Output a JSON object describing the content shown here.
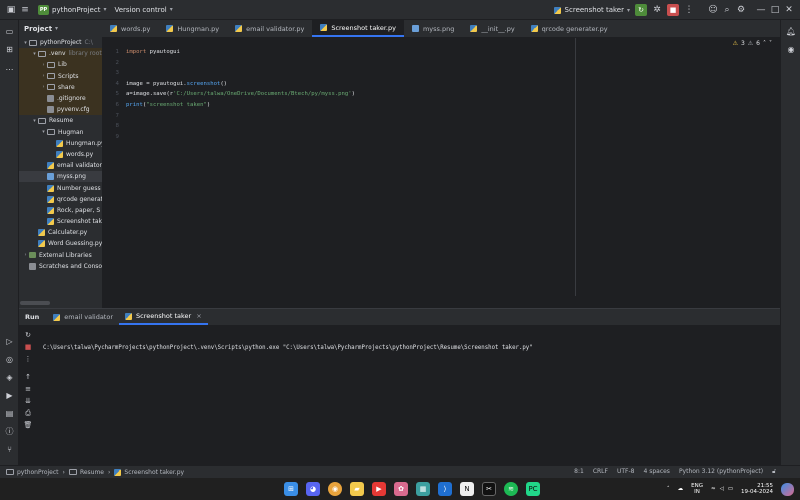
{
  "titlebar": {
    "project_badge": "PP",
    "project_name": "pythonProject",
    "vcs": "Version control",
    "run_config": "Screenshot taker"
  },
  "project_panel": {
    "title": "Project",
    "tree": [
      {
        "label": "pythonProject",
        "note": "C:\\",
        "indent": 0,
        "arrow": "▾",
        "icon": "fold"
      },
      {
        "label": ".venv",
        "note": "library root",
        "indent": 1,
        "arrow": "▾",
        "icon": "fold",
        "venv": true
      },
      {
        "label": "Lib",
        "indent": 2,
        "arrow": "›",
        "icon": "fold",
        "venv": true
      },
      {
        "label": "Scripts",
        "indent": 2,
        "arrow": "›",
        "icon": "fold",
        "venv": true
      },
      {
        "label": "share",
        "indent": 2,
        "arrow": "›",
        "icon": "fold",
        "venv": true
      },
      {
        "label": ".gitignore",
        "indent": 2,
        "arrow": "",
        "icon": "cfg",
        "venv": true
      },
      {
        "label": "pyvenv.cfg",
        "indent": 2,
        "arrow": "",
        "icon": "cfg",
        "venv": true
      },
      {
        "label": "Resume",
        "indent": 1,
        "arrow": "▾",
        "icon": "fold"
      },
      {
        "label": "Hugman",
        "indent": 2,
        "arrow": "▾",
        "icon": "fold"
      },
      {
        "label": "Hungman.py",
        "indent": 3,
        "arrow": "",
        "icon": "py"
      },
      {
        "label": "words.py",
        "indent": 3,
        "arrow": "",
        "icon": "py"
      },
      {
        "label": "email validator",
        "indent": 2,
        "arrow": "",
        "icon": "py"
      },
      {
        "label": "myss.png",
        "indent": 2,
        "arrow": "",
        "icon": "img",
        "sel": true
      },
      {
        "label": "Number guess",
        "indent": 2,
        "arrow": "",
        "icon": "py"
      },
      {
        "label": "qrcode generator",
        "indent": 2,
        "arrow": "",
        "icon": "py"
      },
      {
        "label": "Rock, paper, S",
        "indent": 2,
        "arrow": "",
        "icon": "py"
      },
      {
        "label": "Screenshot taker",
        "indent": 2,
        "arrow": "",
        "icon": "py"
      },
      {
        "label": "Calculater.py",
        "indent": 1,
        "arrow": "",
        "icon": "py"
      },
      {
        "label": "Word Guessing.py",
        "indent": 1,
        "arrow": "",
        "icon": "py"
      },
      {
        "label": "External Libraries",
        "indent": 0,
        "arrow": "›",
        "icon": "lib"
      },
      {
        "label": "Scratches and Consoles",
        "indent": 0,
        "arrow": "",
        "icon": "cfg"
      }
    ]
  },
  "editor_tabs": [
    {
      "label": "words.py",
      "icon": "py"
    },
    {
      "label": "Hungman.py",
      "icon": "py"
    },
    {
      "label": "email validator.py",
      "icon": "py"
    },
    {
      "label": "Screenshot taker.py",
      "icon": "py",
      "active": true
    },
    {
      "label": "myss.png",
      "icon": "img"
    },
    {
      "label": "__init__.py",
      "icon": "py"
    },
    {
      "label": "qrcode generater.py",
      "icon": "py"
    }
  ],
  "editor": {
    "line_numbers": [
      "1",
      "2",
      "3",
      "4",
      "5",
      "6",
      "7",
      "8",
      "9"
    ],
    "inspections": {
      "warnings": "3",
      "weak_warnings": "6"
    },
    "lines": [
      [
        {
          "t": "import ",
          "c": "kw"
        },
        {
          "t": "pyautogui",
          "c": ""
        }
      ],
      [],
      [],
      [
        {
          "t": "image = pyautogui.",
          "c": ""
        },
        {
          "t": "screenshot",
          "c": "fn"
        },
        {
          "t": "()",
          "c": ""
        }
      ],
      [
        {
          "t": "a=image.save(r",
          "c": ""
        },
        {
          "t": "'C:/Users/talwa/OneDrive/Documents/Btech/py/myss.png'",
          "c": "str"
        },
        {
          "t": ")",
          "c": ""
        }
      ],
      [
        {
          "t": "print",
          "c": "fn"
        },
        {
          "t": "(",
          "c": ""
        },
        {
          "t": "\"screenshot taken\"",
          "c": "str"
        },
        {
          "t": ")",
          "c": ""
        }
      ],
      [],
      [],
      []
    ]
  },
  "run_panel": {
    "title": "Run",
    "tabs": [
      {
        "label": "email validator",
        "icon": "py"
      },
      {
        "label": "Screenshot taker",
        "icon": "py",
        "active": true,
        "closable": "×"
      }
    ],
    "console": "C:\\Users\\talwa\\PycharmProjects\\pythonProject\\.venv\\Scripts\\python.exe \"C:\\Users\\talwa\\PycharmProjects\\pythonProject\\Resume\\Screenshot taker.py\""
  },
  "status": {
    "breadcrumb": [
      "pythonProject",
      "Resume",
      "Screenshot taker.py"
    ],
    "position": "8:1",
    "line_sep": "CRLF",
    "encoding": "UTF-8",
    "indent": "4 spaces",
    "interpreter": "Python 3.12 (pythonProject)"
  },
  "taskbar": {
    "lang": "ENG",
    "region": "IN",
    "time": "21:55",
    "date": "19-04-2024"
  }
}
